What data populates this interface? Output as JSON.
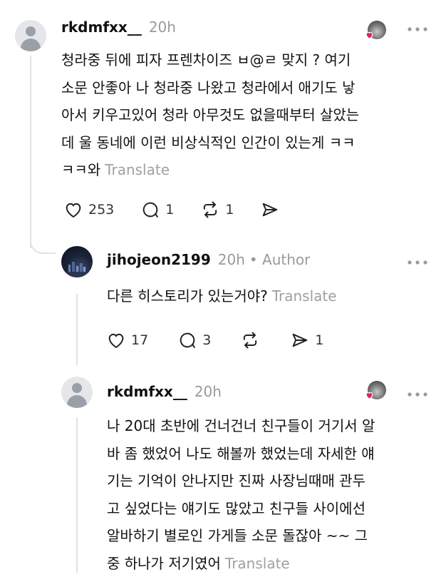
{
  "comments": [
    {
      "username": "rkdmfxx__",
      "time": "20h",
      "lines": [
        "청라중 뒤에 피자 프렌차이즈 ㅂ@ㄹ 맞지 ? 여기",
        "소문 안좋아 나 청라중 나왔고 청라에서 애기도 낳",
        "아서 키우고있어 청라 아무것도 없을때부터 살았는",
        "데 울 동네에 이런 비상식적인 인간이 있는게 ㅋㅋ",
        "ㅋㅋ와"
      ],
      "translate": "Translate",
      "likes": "253",
      "replies": "1",
      "reposts": "1",
      "shares": ""
    },
    {
      "username": "jihojeon2199",
      "time": "20h",
      "author_badge": "• Author",
      "lines": [
        "다른 히스토리가 있는거야?"
      ],
      "translate": "Translate",
      "likes": "17",
      "replies": "3",
      "reposts": "",
      "shares": "1"
    },
    {
      "username": "rkdmfxx__",
      "time": "20h",
      "lines": [
        "나 20대 초반에 건너건너 친구들이 거기서 알",
        "바 좀 했었어 나도 해볼까 했었는데 자세한 얘",
        "기는 기억이 안나지만 진짜 사장님때매 관두",
        "고 싶었다는 얘기도 많았고 친구들 사이에선",
        "알바하기 별로인 가게들 소문 돌잖아 ~~ 그",
        "중 하나가 저기였어"
      ],
      "translate": "Translate"
    }
  ],
  "icons": {
    "more": "more-horizontal-icon",
    "like": "heart-icon",
    "reply": "comment-icon",
    "repost": "repost-icon",
    "share": "send-icon"
  },
  "colors": {
    "heart_badge": "#e0245e",
    "muted": "#9a9a9a"
  }
}
